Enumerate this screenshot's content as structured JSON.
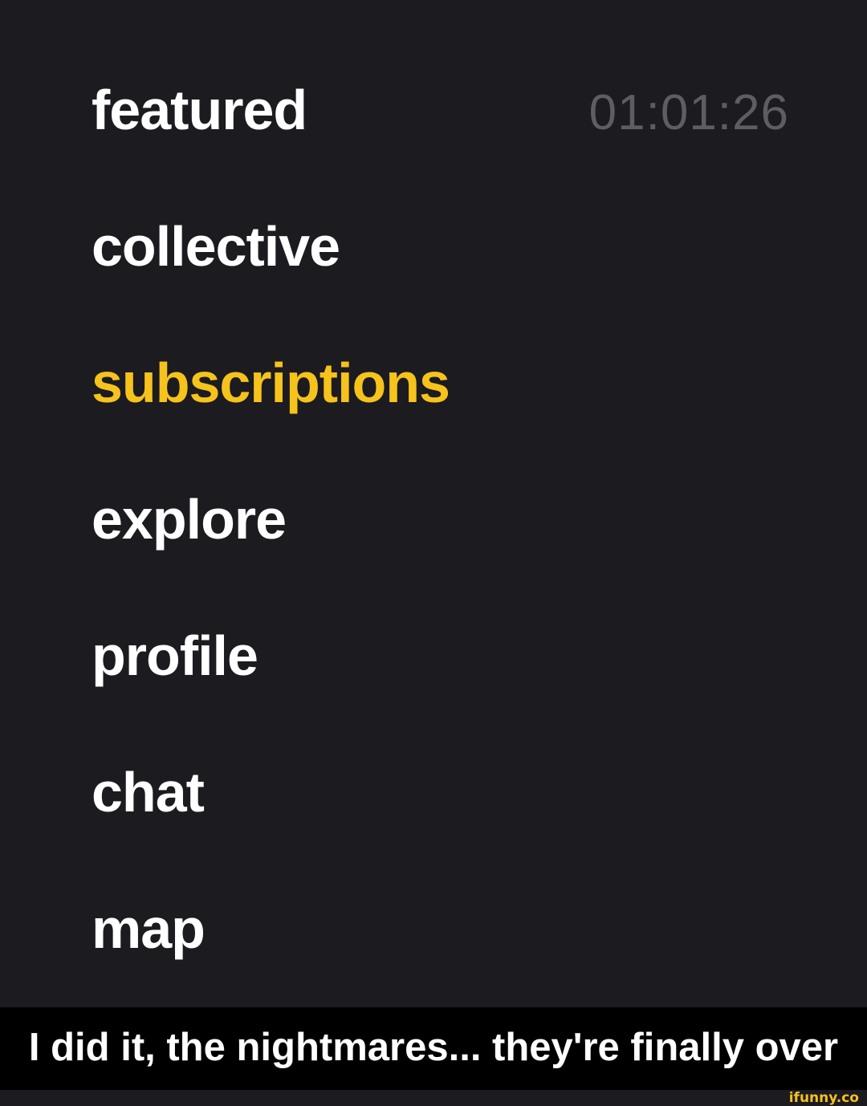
{
  "colors": {
    "background": "#1b1b20",
    "text": "#ffffff",
    "active": "#f6c21c",
    "timer": "#5d5d63",
    "caption_bar": "#000000"
  },
  "menu": {
    "items": [
      {
        "label": "featured",
        "active": false
      },
      {
        "label": "collective",
        "active": false
      },
      {
        "label": "subscriptions",
        "active": true
      },
      {
        "label": "explore",
        "active": false
      },
      {
        "label": "profile",
        "active": false
      },
      {
        "label": "chat",
        "active": false
      },
      {
        "label": "map",
        "active": false
      }
    ]
  },
  "timer": "01:01:26",
  "caption": "I did it, the nightmares... they're finally over",
  "watermark": "ifunny.co"
}
